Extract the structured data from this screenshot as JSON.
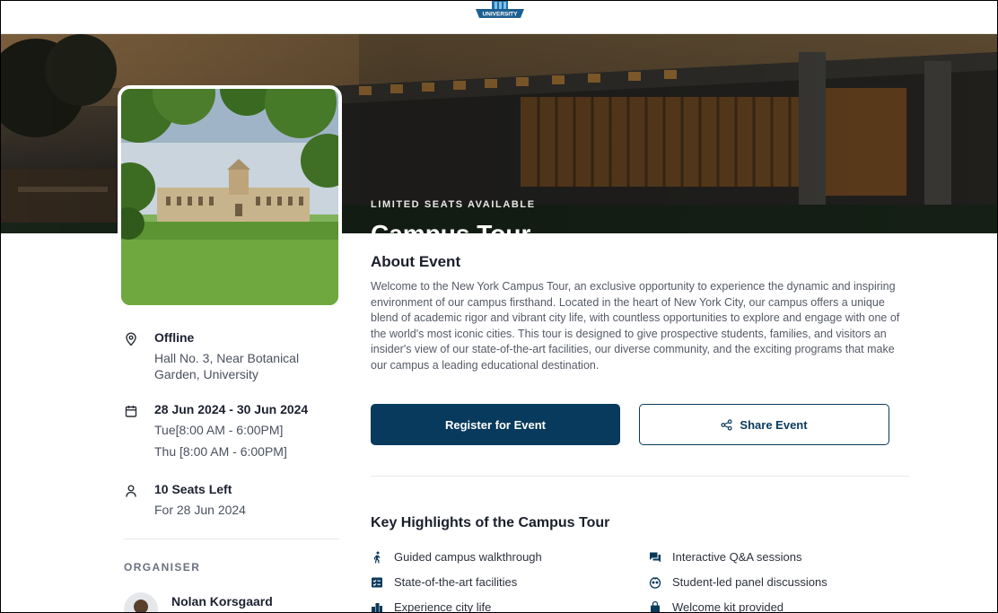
{
  "header": {
    "logo_text": "UNIVERSITY"
  },
  "hero": {
    "eyebrow": "LIMITED SEATS AVAILABLE",
    "title": "Campus Tour"
  },
  "event_info": {
    "location": {
      "title": "Offline",
      "line1": "Hall No. 3, Near Botanical",
      "line2": "Garden, University"
    },
    "date": {
      "title": "28 Jun 2024 - 30 Jun 2024",
      "line1": "Tue[8:00 AM - 6:00PM]",
      "line2": "Thu [8:00 AM - 6:00PM]"
    },
    "seats": {
      "title": "10 Seats Left",
      "line1": "For 28 Jun 2024"
    }
  },
  "organiser": {
    "label": "ORGANISER",
    "name": "Nolan Korsgaard"
  },
  "about": {
    "title": "About Event",
    "text": "Welcome to the New York Campus Tour, an exclusive opportunity to experience the dynamic and inspiring environment of our campus firsthand. Located in the heart of New York City, our campus offers a unique blend of academic rigor and vibrant city life, with countless opportunities to explore and engage with one of the world's most iconic cities. This tour is designed to give prospective students, families, and visitors an insider's view of our state-of-the-art facilities, our diverse community, and the exciting programs that make our campus a leading educational destination."
  },
  "actions": {
    "register_label": "Register for Event",
    "share_label": "Share Event"
  },
  "highlights": {
    "title": "Key Highlights of the Campus Tour",
    "items": [
      {
        "label": "Guided campus walkthrough",
        "icon": "walking-person-icon"
      },
      {
        "label": "Interactive Q&A sessions",
        "icon": "chat-bubbles-icon"
      },
      {
        "label": "State-of-the-art facilities",
        "icon": "checklist-icon"
      },
      {
        "label": "Student-led panel discussions",
        "icon": "discussion-icon"
      },
      {
        "label": "Experience city life",
        "icon": "city-icon"
      },
      {
        "label": "Welcome kit provided",
        "icon": "bag-icon"
      }
    ]
  },
  "colors": {
    "primary": "#073a5c",
    "text": "#1a1f2b",
    "muted": "#545a67"
  }
}
